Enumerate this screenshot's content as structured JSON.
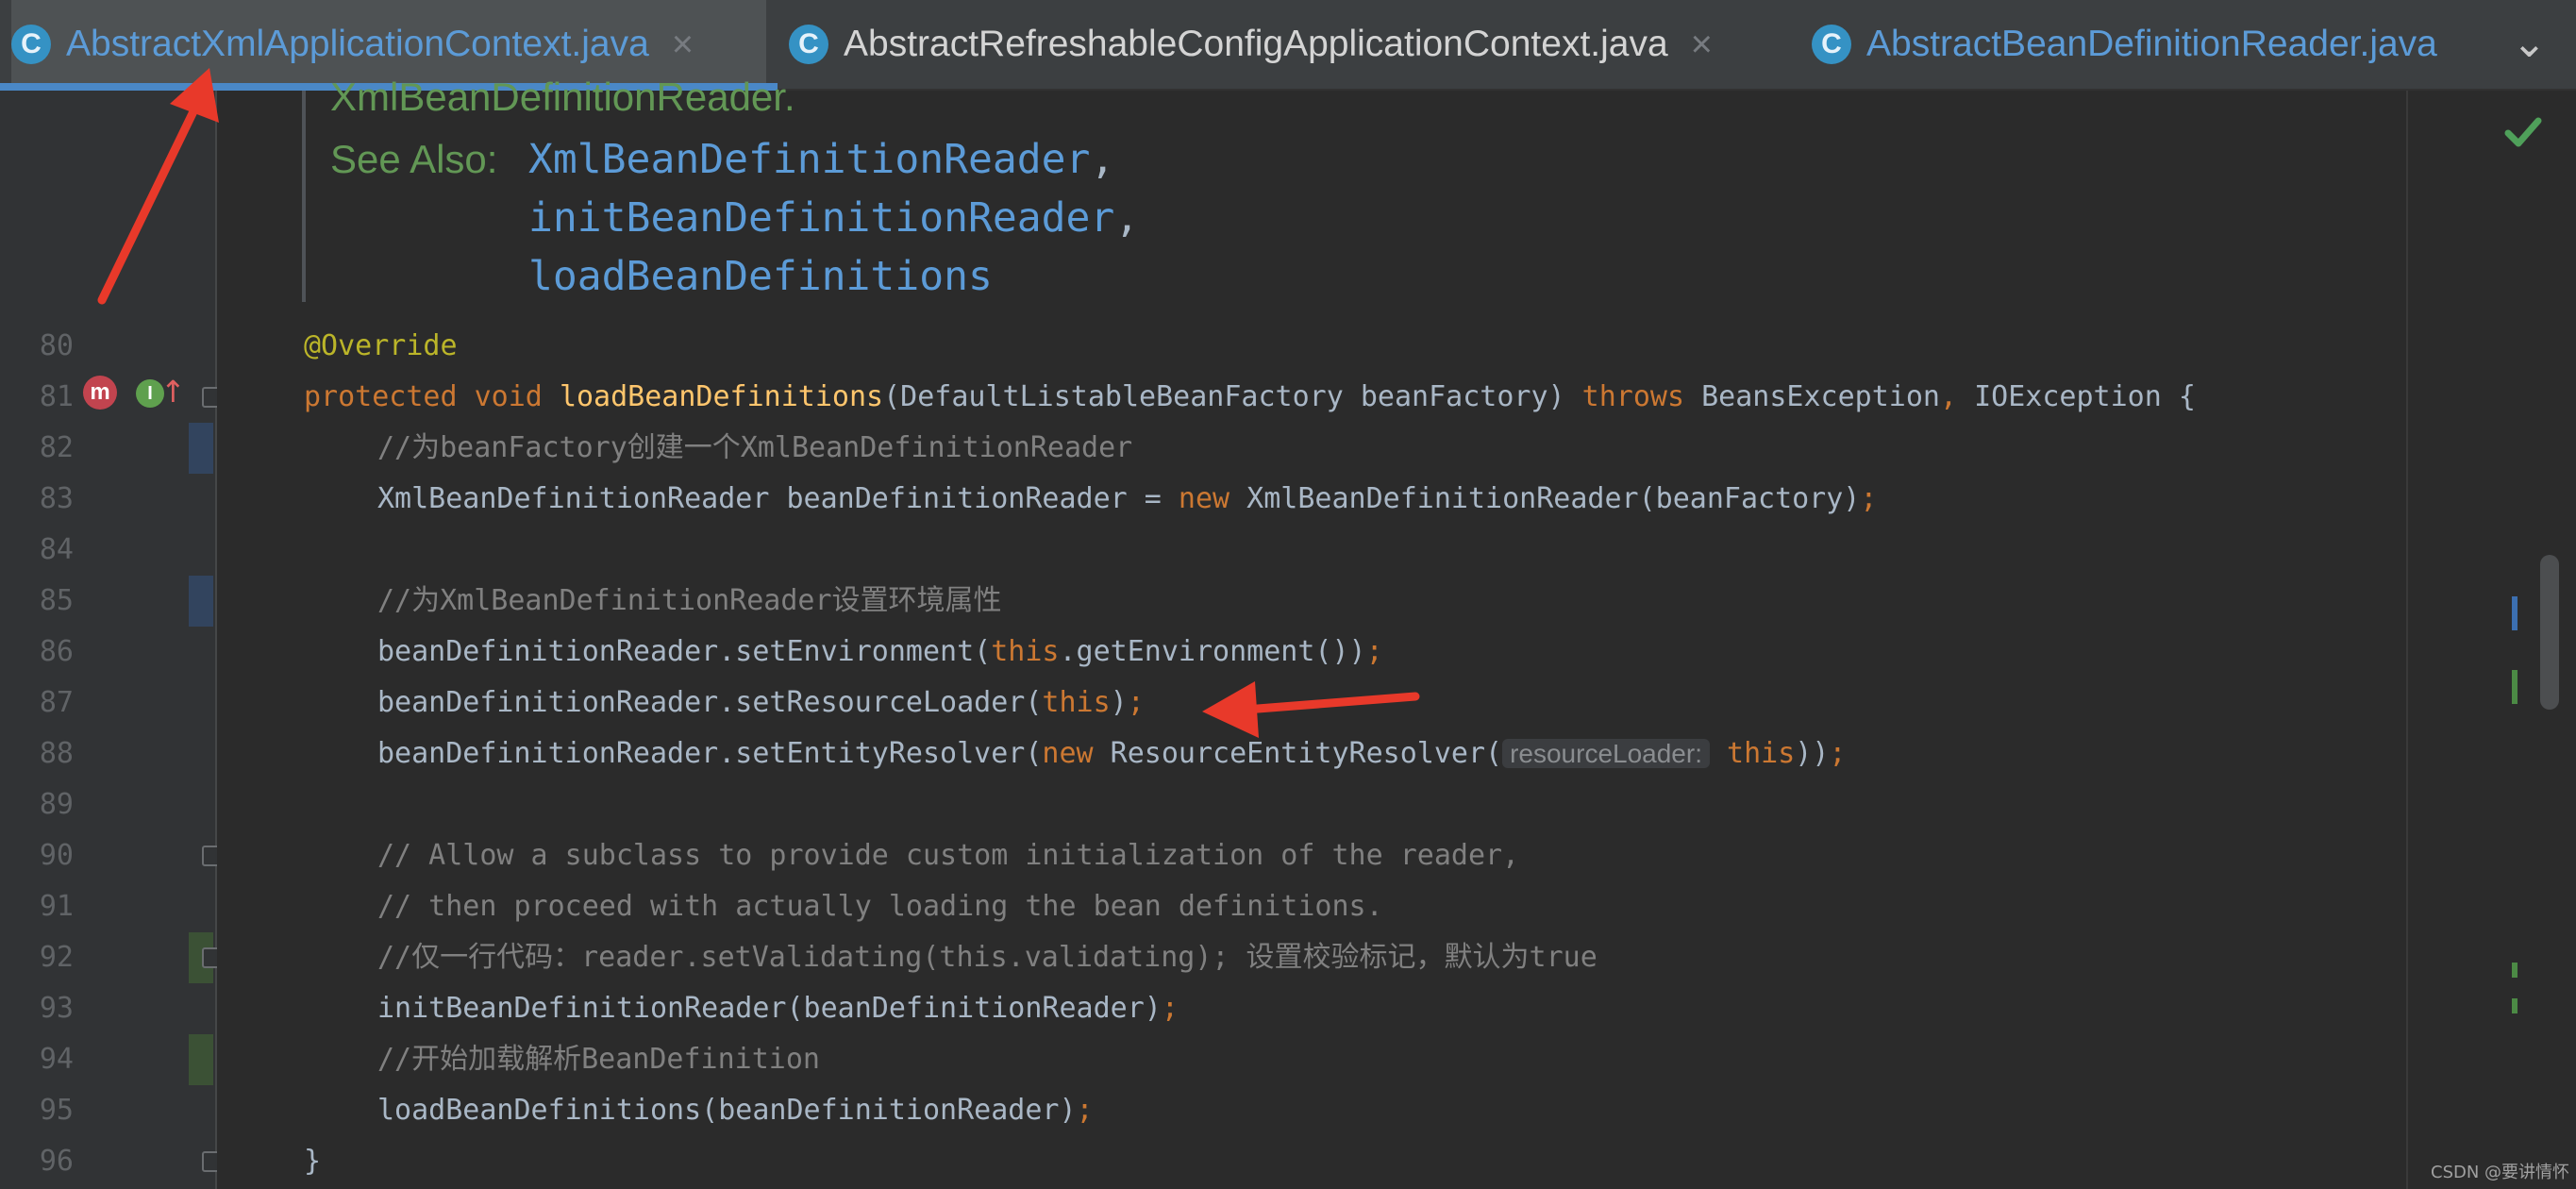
{
  "tabs": [
    {
      "label": "AbstractXmlApplicationContext.java",
      "icon": "class-icon",
      "active": true
    },
    {
      "label": "AbstractRefreshableConfigApplicationContext.java",
      "icon": "class-icon",
      "active": false
    },
    {
      "label": "AbstractBeanDefinitionReader.java",
      "icon": "class-icon",
      "active": false
    }
  ],
  "tab_icon_letter": "C",
  "close_glyph": "×",
  "overflow_glyph": "⌄",
  "javadoc": {
    "partial_line": "XmlBeanDefinitionReader.",
    "see_also_label": "See Also:",
    "links": [
      "XmlBeanDefinitionReader",
      "initBeanDefinitionReader",
      "loadBeanDefinitions"
    ],
    "separator": ","
  },
  "gutter_icons": {
    "override": "m",
    "implements": "I",
    "implements_arrow": "↑"
  },
  "code": {
    "line_numbers": [
      "80",
      "81",
      "82",
      "83",
      "84",
      "85",
      "86",
      "87",
      "88",
      "89",
      "90",
      "91",
      "92",
      "93",
      "94",
      "95",
      "96"
    ],
    "l80": "@Override",
    "l81": {
      "kw": "protected void ",
      "fn": "loadBeanDefinitions",
      "a": "(DefaultListableBeanFactory beanFactory) ",
      "kw2": "throws ",
      "b": "BeansException",
      "c": ", ",
      "d": "IOException {"
    },
    "l82": "//为beanFactory创建一个XmlBeanDefinitionReader",
    "l83": {
      "a": "XmlBeanDefinitionReader beanDefinitionReader = ",
      "kw": "new ",
      "b": "XmlBeanDefinitionReader(beanFactory)",
      "c": ";"
    },
    "l85": "//为XmlBeanDefinitionReader设置环境属性",
    "l86": {
      "a": "beanDefinitionReader.setEnvironment(",
      "kw": "this",
      "b": ".getEnvironment())",
      "c": ";"
    },
    "l87": {
      "a": "beanDefinitionReader.setResourceLoader(",
      "kw": "this",
      "b": ")",
      "c": ";"
    },
    "l88": {
      "a": "beanDefinitionReader.setEntityResolver(",
      "kw": "new ",
      "b": "ResourceEntityResolver(",
      "hint": "resourceLoader:",
      "kw2": "this",
      "c": "))",
      "d": ";"
    },
    "l90": "// Allow a subclass to provide custom initialization of the reader,",
    "l91": "// then proceed with actually loading the bean definitions.",
    "l92": "//仅一行代码：reader.setValidating(this.validating); 设置校验标记，默认为true",
    "l93": {
      "a": "initBeanDefinitionReader(beanDefinitionReader)",
      "c": ";"
    },
    "l94": "//开始加载解析BeanDefinition",
    "l95": {
      "a": "loadBeanDefinitions(beanDefinitionReader)",
      "c": ";"
    },
    "l96": "}"
  },
  "annotations": {
    "arrows": 2,
    "arrow_color": "#e8392a"
  },
  "status": {
    "inspection": "check-icon"
  },
  "watermark": "CSDN @要讲情怀"
}
